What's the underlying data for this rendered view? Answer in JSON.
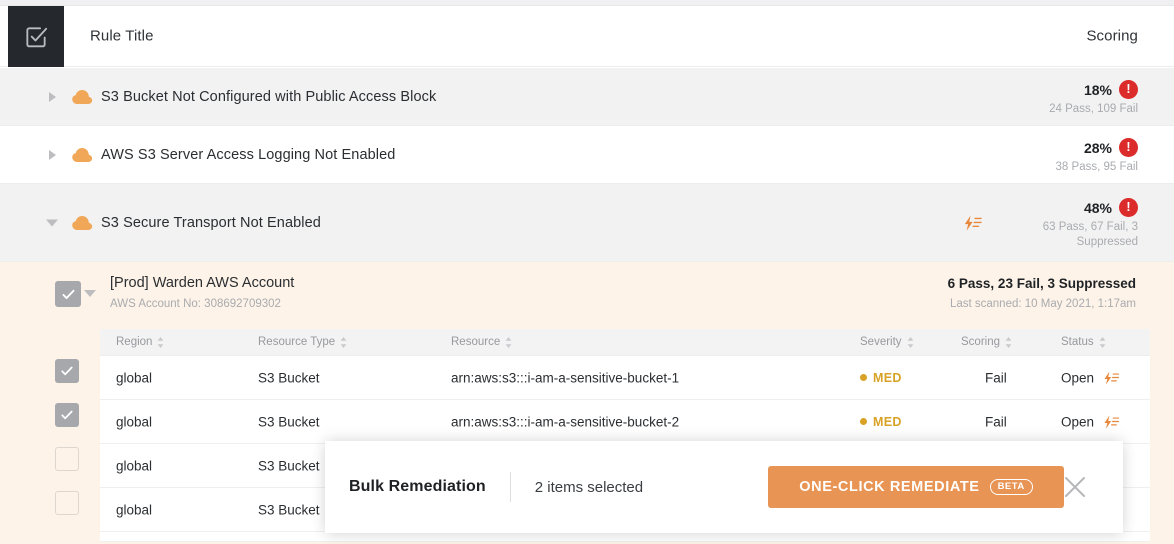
{
  "header": {
    "checkbox_icon": "checkbox-check-icon",
    "title": "Rule Title",
    "scoring_label": "Scoring"
  },
  "rules": [
    {
      "caret": "caret-right-icon",
      "icon": "cloud-icon",
      "title": "S3 Bucket Not Configured with Public Access Block",
      "score_pct": "18%",
      "badge": "!",
      "summary": "24 Pass, 109 Fail",
      "expanded": false,
      "has_bolt": false
    },
    {
      "caret": "caret-right-icon",
      "icon": "cloud-icon",
      "title": "AWS S3 Server Access Logging Not Enabled",
      "score_pct": "28%",
      "badge": "!",
      "summary": "38 Pass, 95 Fail",
      "expanded": false,
      "has_bolt": false
    },
    {
      "caret": "caret-down-icon",
      "icon": "cloud-icon",
      "title": "S3 Secure Transport Not Enabled",
      "score_pct": "48%",
      "badge": "!",
      "summary": "63 Pass, 67 Fail, 3 Suppressed",
      "expanded": true,
      "has_bolt": true
    }
  ],
  "account": {
    "checkbox_state": "checked",
    "caret": "caret-down-icon",
    "name": "[Prod] Warden AWS Account",
    "account_no": "AWS Account No: 308692709302",
    "stats": "6 Pass, 23 Fail, 3 Suppressed",
    "last_scanned": "Last scanned: 10 May 2021, 1:17am"
  },
  "table": {
    "columns": [
      {
        "label": "Region",
        "sortable": true
      },
      {
        "label": "Resource Type",
        "sortable": true
      },
      {
        "label": "Resource",
        "sortable": true
      },
      {
        "label": "Severity",
        "sortable": true
      },
      {
        "label": "Scoring",
        "sortable": true
      },
      {
        "label": "Status",
        "sortable": true
      }
    ],
    "rows": [
      {
        "selected": true,
        "region": "global",
        "resource_type": "S3 Bucket",
        "resource": "arn:aws:s3:::i-am-a-sensitive-bucket-1",
        "severity": "MED",
        "scoring": "Fail",
        "status": "Open",
        "action_icon": "lightning-bolt-icon"
      },
      {
        "selected": true,
        "region": "global",
        "resource_type": "S3 Bucket",
        "resource": "arn:aws:s3:::i-am-a-sensitive-bucket-2",
        "severity": "MED",
        "scoring": "Fail",
        "status": "Open",
        "action_icon": "lightning-bolt-icon"
      },
      {
        "selected": false,
        "region": "global",
        "resource_type": "S3 Bucket",
        "resource": "",
        "severity": "",
        "scoring": "",
        "status": "",
        "action_icon": "lightning-bolt-icon"
      },
      {
        "selected": false,
        "region": "global",
        "resource_type": "S3 Bucket",
        "resource": "",
        "severity": "",
        "scoring": "",
        "status": "",
        "action_icon": "lightning-bolt-icon"
      }
    ]
  },
  "toast": {
    "title": "Bulk Remediation",
    "count_text": "2 items selected",
    "button_label": "ONE-CLICK REMEDIATE",
    "button_badge": "BETA",
    "close_icon": "close-icon"
  },
  "colors": {
    "accent_orange": "#e89454",
    "cloud_orange": "#f0a757",
    "error_red": "#dc2b2b",
    "severity_med": "#d8a227",
    "account_bg": "#fdf3e8",
    "row_shade": "#f2f2f3",
    "header_dark": "#25282c"
  }
}
